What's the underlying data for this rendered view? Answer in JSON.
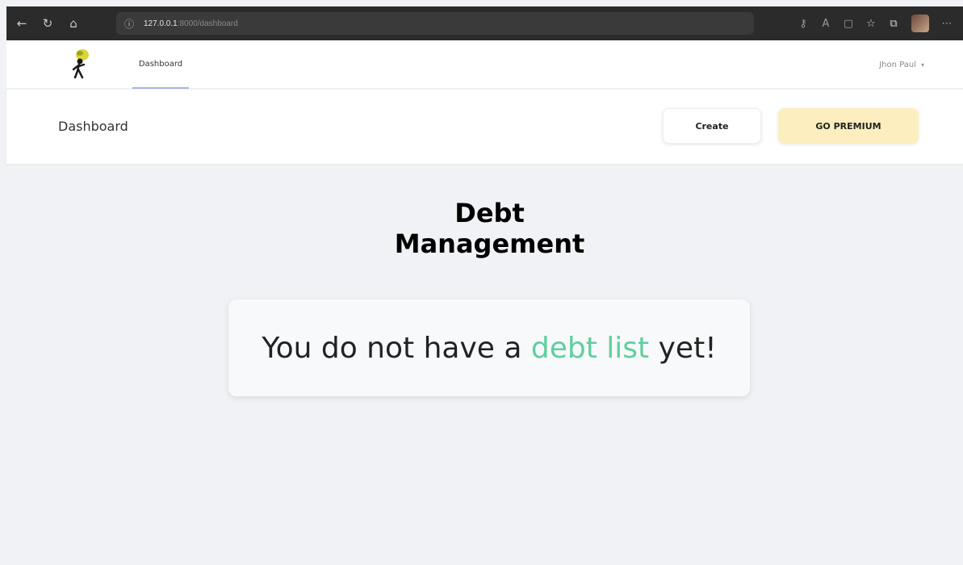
{
  "browser": {
    "url_host": "127.0.0.1",
    "url_path": ":8000/dashboard",
    "icons": [
      "back-icon",
      "refresh-icon",
      "home-icon",
      "info-icon",
      "key-icon",
      "read-aloud-icon",
      "screen-icon",
      "favorites-icon",
      "collections-icon",
      "profile-icon",
      "more-icon"
    ]
  },
  "nav": {
    "tab_label": "Dashboard",
    "user_name": "Jhon Paul"
  },
  "header": {
    "title": "Dashboard",
    "create_label": "Create",
    "premium_label": "GO PREMIUM"
  },
  "main": {
    "heading_line1": "Debt",
    "heading_line2": "Management",
    "empty_prefix": "You do not have a",
    "empty_link": "debt list",
    "empty_suffix": "yet!"
  },
  "colors": {
    "accent_green": "#5fcf9e",
    "premium_bg": "#fdeebf",
    "tab_underline": "#a7b4e6"
  }
}
